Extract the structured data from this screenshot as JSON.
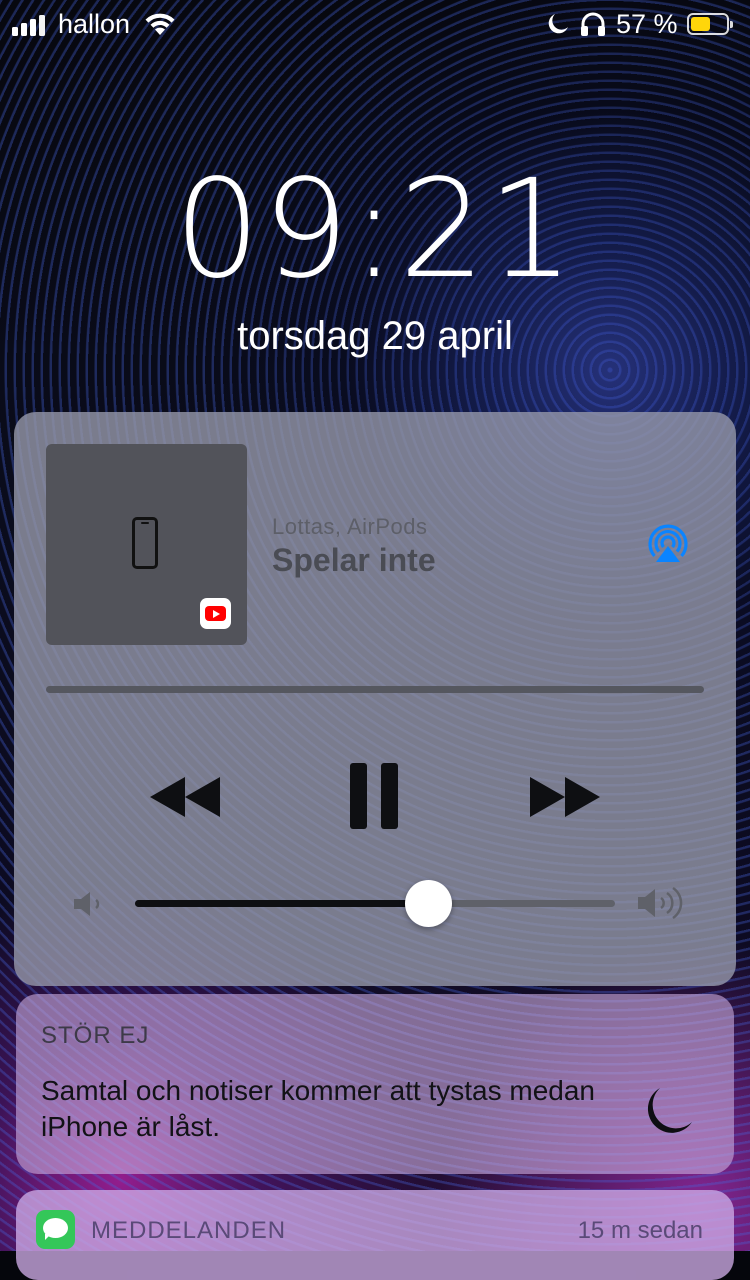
{
  "status_bar": {
    "carrier": "hallon",
    "battery_percent": "57 %",
    "battery_level": 0.57,
    "battery_color": "#ffd60a",
    "icons": [
      "signal-icon",
      "wifi-icon",
      "do-not-disturb-icon",
      "headphones-icon",
      "battery-icon"
    ]
  },
  "lock_screen": {
    "time": "09:21",
    "date": "torsdag 29 april"
  },
  "now_playing": {
    "route": "Lottas, AirPods",
    "title": "Spelar inte",
    "volume_level": 0.61,
    "accent_color": "#0a84ff",
    "icons": [
      "phone-icon",
      "youtube-icon",
      "airplay-icon",
      "rewind-icon",
      "pause-icon",
      "fast-forward-icon",
      "volume-low-icon",
      "volume-high-icon"
    ]
  },
  "do_not_disturb": {
    "title": "STÖR EJ",
    "body": "Samtal och notiser kommer att tystas medan iPhone är låst.",
    "icon": "moon-icon"
  },
  "messages_notification": {
    "app": "MEDDELANDEN",
    "time": "15 m sedan",
    "icon": "messages-icon",
    "icon_color": "#34c759"
  }
}
